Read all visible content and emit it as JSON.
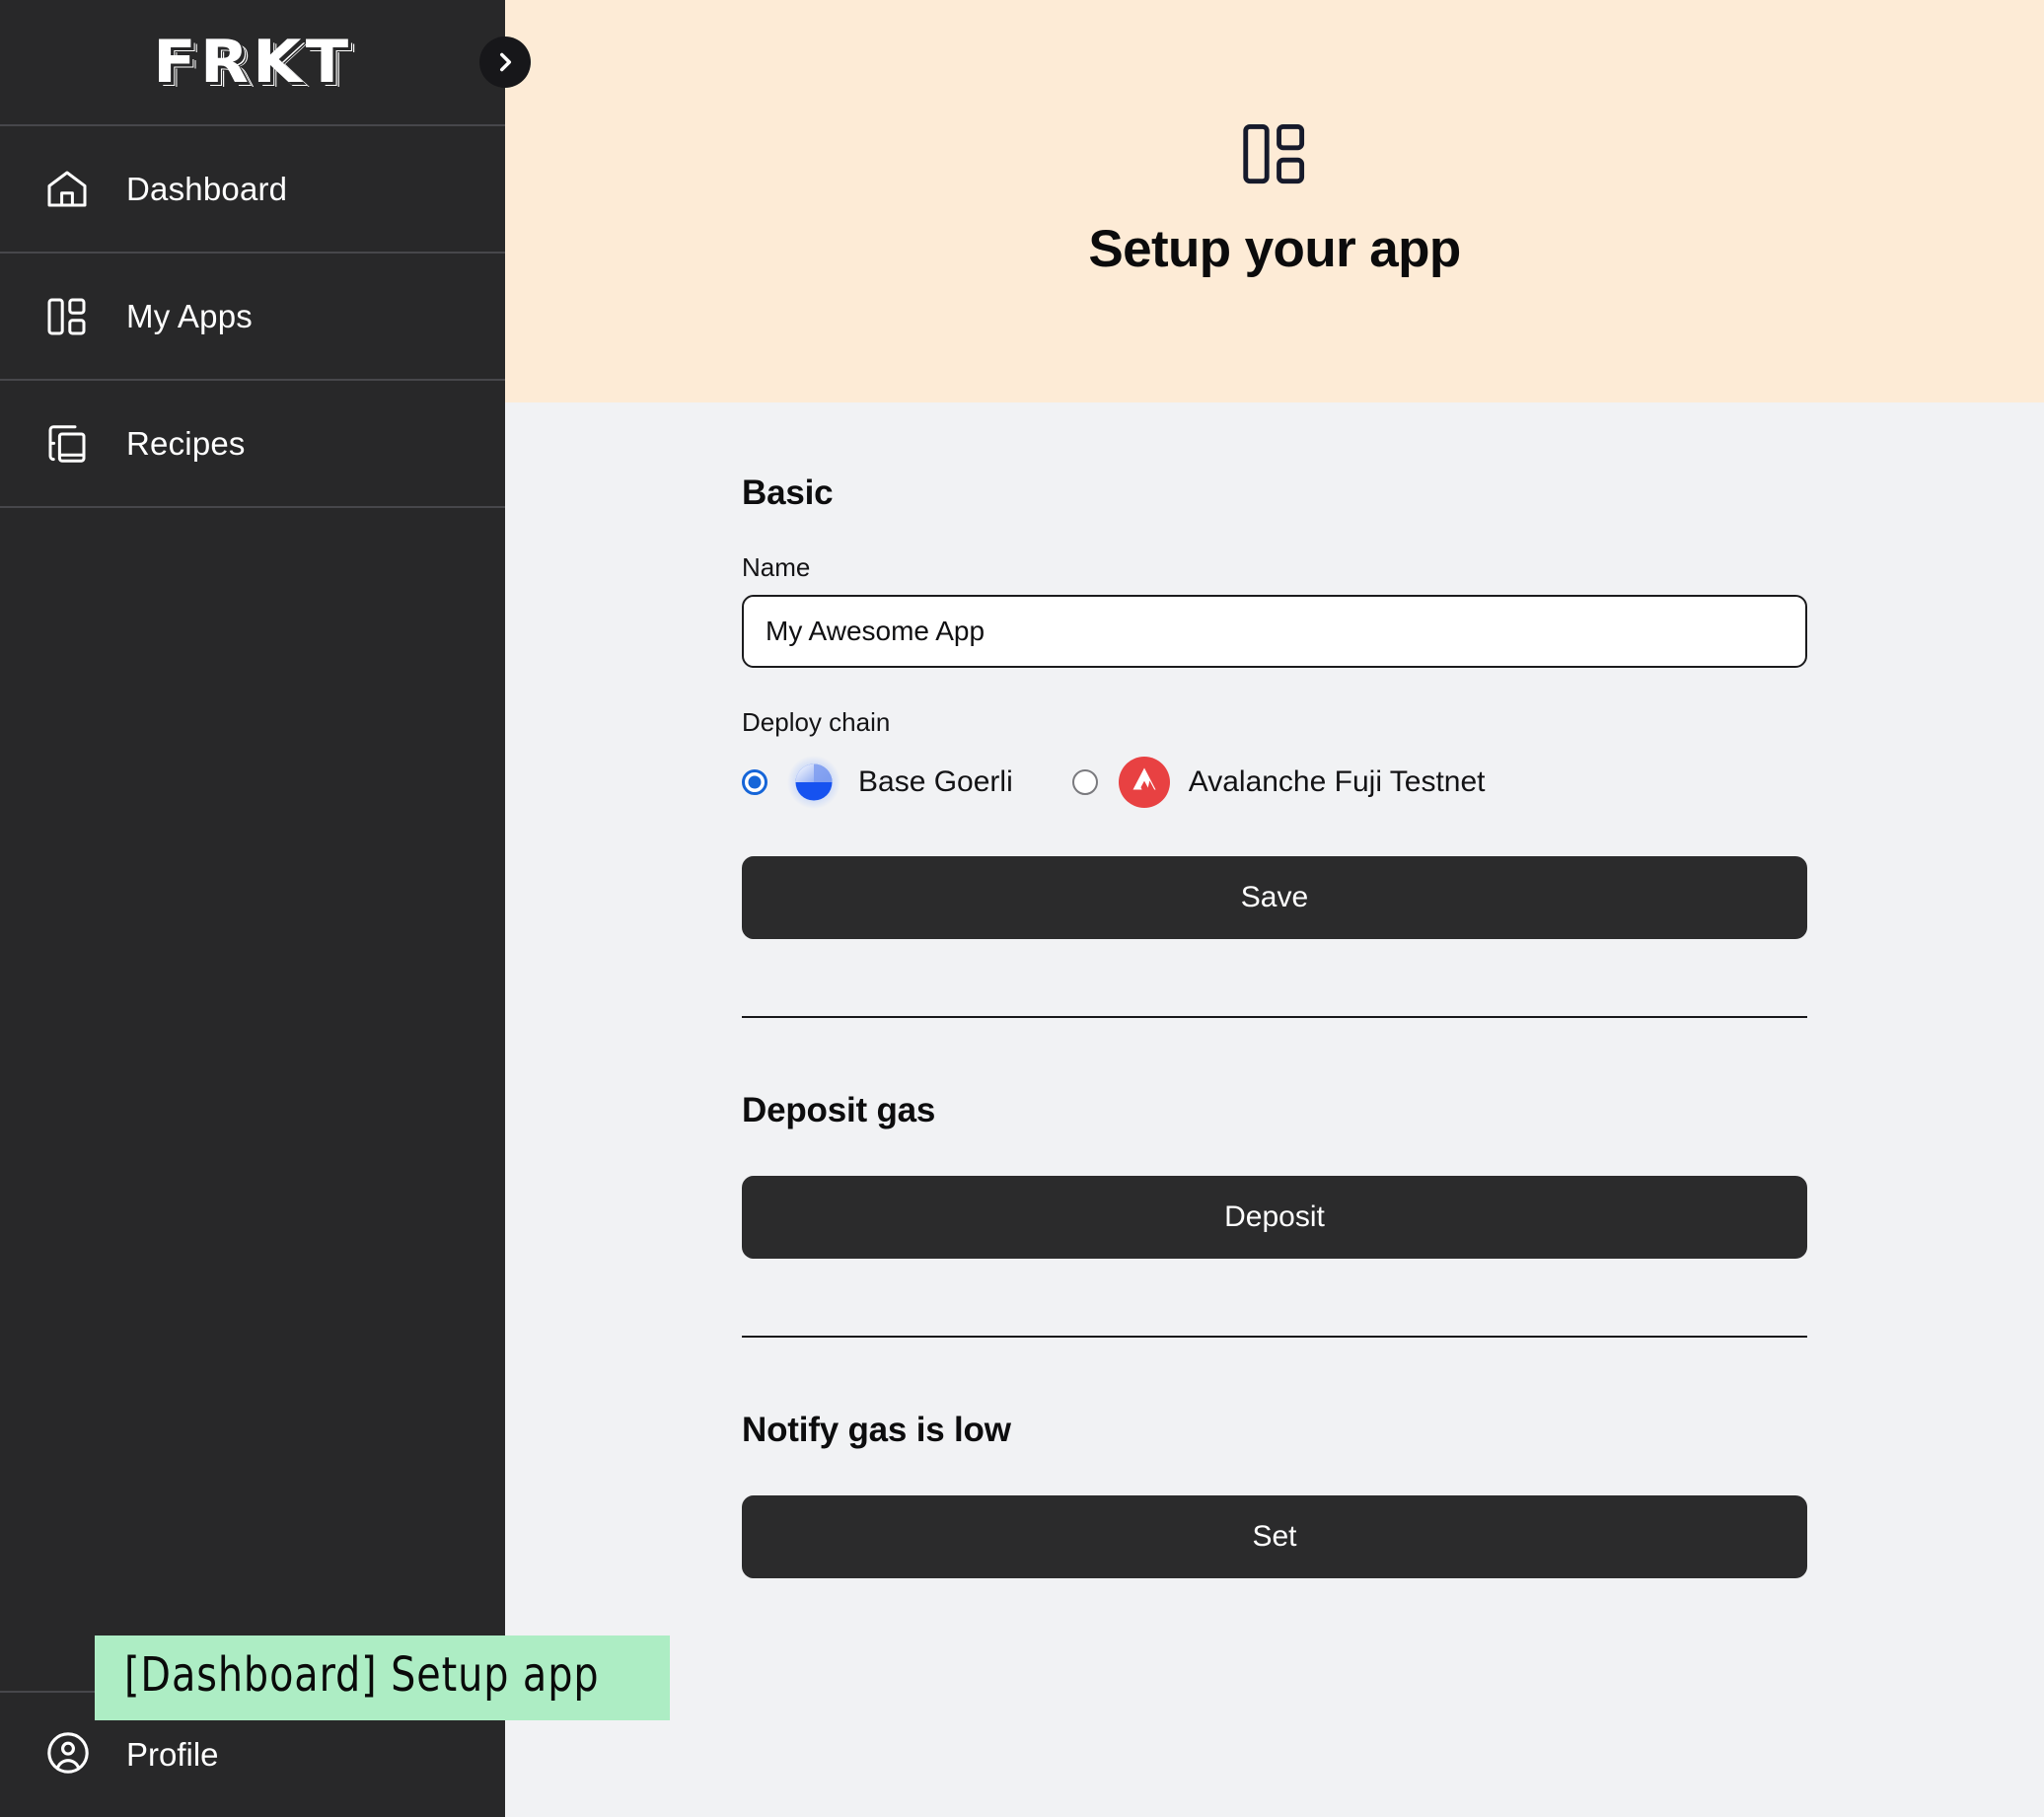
{
  "sidebar": {
    "brand": "FRKT",
    "collapse_icon": "chevron-right-icon",
    "items": [
      {
        "label": "Dashboard",
        "icon": "home-icon"
      },
      {
        "label": "My Apps",
        "icon": "layout-dashboard-icon"
      },
      {
        "label": "Recipes",
        "icon": "books-copy-icon"
      }
    ],
    "profile": {
      "label": "Profile",
      "icon": "user-circle-icon"
    }
  },
  "header": {
    "icon": "layout-dashboard-icon",
    "title": "Setup your app",
    "bg_color": "#FDEBD6"
  },
  "main": {
    "bg_color": "#F1F2F4",
    "basic": {
      "title": "Basic",
      "name_label": "Name",
      "name_value": "My Awesome App",
      "name_placeholder": "Name",
      "chain_label": "Deploy chain",
      "chains": [
        {
          "name": "Base Goerli",
          "selected": true,
          "icon": "base-chain-icon",
          "color": "#1652F0"
        },
        {
          "name": "Avalanche Fuji Testnet",
          "selected": false,
          "icon": "avalanche-chain-icon",
          "color": "#E84142"
        }
      ],
      "save_label": "Save"
    },
    "deposit_gas": {
      "title": "Deposit gas",
      "button_label": "Deposit"
    },
    "notify_gas_low": {
      "title": "Notify gas is low",
      "button_label": "Set"
    }
  },
  "annotation": {
    "text": "[Dashboard] Setup app",
    "bg_color": "#ADEDC4"
  }
}
